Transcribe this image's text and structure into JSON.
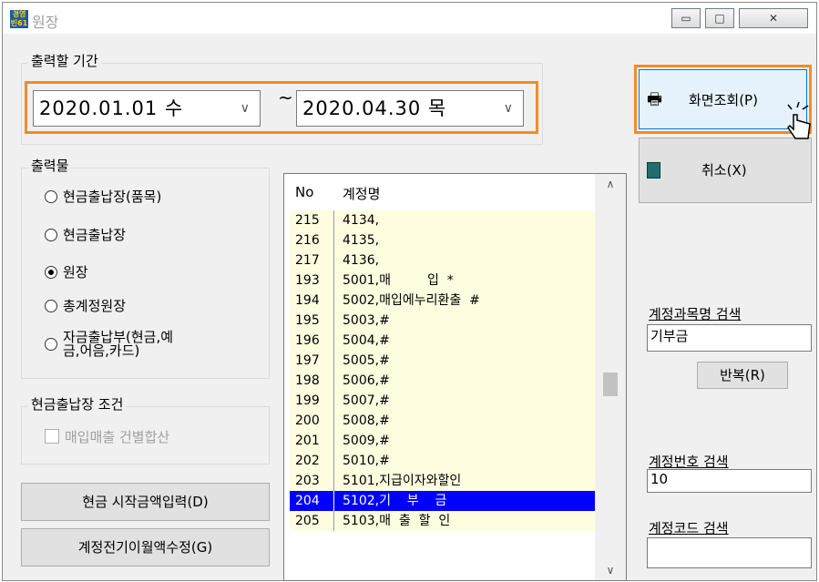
{
  "window": {
    "title": "원장",
    "app_icon_text": "경영빈61",
    "minimize_glyph": "▭",
    "maximize_glyph": "□",
    "close_glyph": "✕"
  },
  "period": {
    "label": "출력할 기간",
    "start": "2020.01.01 수",
    "end": "2020.04.30 목",
    "separator": "~",
    "dropdown_glyph": "∨"
  },
  "output": {
    "label": "출력물",
    "options": [
      {
        "label": "현금출납장(품목)",
        "selected": false
      },
      {
        "label": "현금출납장",
        "selected": false
      },
      {
        "label": "원장",
        "selected": true
      },
      {
        "label": "총계정원장",
        "selected": false
      },
      {
        "label": "자금출납부(현금,예\n금,어음,카드)",
        "selected": false
      }
    ]
  },
  "cash_condition": {
    "label": "현금출납장 조건",
    "checkbox_label": "매입매출 건별합산"
  },
  "buttons": {
    "cash_start": "현금 시작금액입력(D)",
    "prev_balance": "계정전기이월액수정(G)",
    "view": "화면조회(P)",
    "cancel": "취소(X)",
    "repeat": "반복(R)"
  },
  "list": {
    "col_no": "No",
    "col_name": "계정명",
    "rows": [
      {
        "no": "215",
        "name": "4134,"
      },
      {
        "no": "216",
        "name": "4135,"
      },
      {
        "no": "217",
        "name": "4136,"
      },
      {
        "no": "193",
        "name": "5001,매         입  *"
      },
      {
        "no": "194",
        "name": "5002,매입에누리환출  #"
      },
      {
        "no": "195",
        "name": "5003,#"
      },
      {
        "no": "196",
        "name": "5004,#"
      },
      {
        "no": "197",
        "name": "5005,#"
      },
      {
        "no": "198",
        "name": "5006,#"
      },
      {
        "no": "199",
        "name": "5007,#"
      },
      {
        "no": "200",
        "name": "5008,#"
      },
      {
        "no": "201",
        "name": "5009,#"
      },
      {
        "no": "202",
        "name": "5010,#"
      },
      {
        "no": "203",
        "name": "5101,지급이자와할인"
      },
      {
        "no": "204",
        "name": "5102,기    부    금",
        "selected": true
      },
      {
        "no": "205",
        "name": "5103,매  출  할  인"
      }
    ],
    "scroll_up_glyph": "∧",
    "scroll_down_glyph": "∨"
  },
  "search": {
    "subject_label": "계정과목명 검색",
    "subject_value": "기부금",
    "number_label": "계정번호 검색",
    "number_value": "10",
    "code_label": "계정코드 검색",
    "code_value": ""
  }
}
